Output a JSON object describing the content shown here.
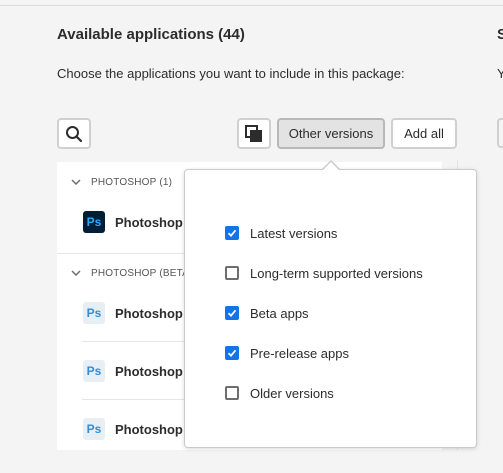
{
  "header": {
    "title": "Available applications (44)",
    "subtitle": "Choose the applications you want to include in this package:"
  },
  "right_panel": {
    "title": "S",
    "subtitle": "Y"
  },
  "toolbar": {
    "search_icon": "search-icon",
    "toggle_icon": "stacked-windows-icon",
    "other_versions_label": "Other versions",
    "add_all_label": "Add all"
  },
  "list": {
    "groups": [
      {
        "label": "PHOTOSHOP (1)",
        "items": [
          {
            "name": "Photoshop",
            "icon": "photoshop-icon",
            "icon_text": "Ps"
          }
        ]
      },
      {
        "label": "PHOTOSHOP (BETA)",
        "items": [
          {
            "name": "Photoshop (",
            "icon": "photoshop-beta-icon",
            "icon_text": "Ps"
          },
          {
            "name": "Photoshop (",
            "icon": "photoshop-beta-icon",
            "icon_text": "Ps"
          },
          {
            "name": "Photoshop (",
            "icon": "photoshop-beta-icon",
            "icon_text": "Ps"
          }
        ]
      }
    ]
  },
  "popover": {
    "options": [
      {
        "label": "Latest versions",
        "checked": true
      },
      {
        "label": "Long-term supported versions",
        "checked": false
      },
      {
        "label": "Beta apps",
        "checked": true
      },
      {
        "label": "Pre-release apps",
        "checked": true
      },
      {
        "label": "Older versions",
        "checked": false
      }
    ]
  },
  "colors": {
    "accent": "#1473e6",
    "ps_bg": "#001e36",
    "ps_text": "#31a8ff"
  }
}
